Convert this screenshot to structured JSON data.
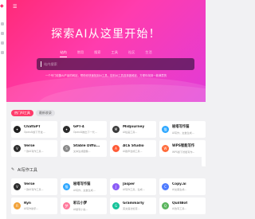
{
  "hero": {
    "title": "探索AI从这里开始！",
    "tabs": [
      "站内",
      "常用",
      "搜索",
      "工具",
      "社区",
      "生活"
    ],
    "search_placeholder": "站内搜索",
    "subtitle": "一个专门收集AI产品的网站，帮助你快速找到AI工具，告别AI工具选择困难症，方便你找到一款满意的"
  },
  "filters": [
    "热门AI工具",
    "最新收录"
  ],
  "section_title": "AI写作工具",
  "icons": {
    "menu": "hamburger-icon",
    "section": "pen-icon"
  },
  "cards_top": [
    {
      "name": "ChatGPT",
      "desc": "OpenAI旗下开发...",
      "icon_text": "✦",
      "color": "#1f1f1f"
    },
    {
      "name": "GPT-4",
      "desc": "OpenAI推出下一代...",
      "icon_text": "✦",
      "color": "#2b2b2b"
    },
    {
      "name": "Midjourney",
      "desc": "AI绘画工具...",
      "icon_text": "M",
      "color": "#3a3a3a"
    },
    {
      "name": "秘塔写作猫",
      "desc": "AI写作，文章生成...",
      "icon_text": "猫",
      "color": "#2da7ff"
    },
    {
      "name": "Verse",
      "desc": "一款AI写作工具...",
      "icon_text": "V",
      "color": "#2c2c2c"
    },
    {
      "name": "Stable Diffu...",
      "desc": "文本生成图像...",
      "icon_text": "S",
      "color": "#8a8a8a"
    },
    {
      "name": "ACE Studio",
      "desc": "AI歌声合成工具...",
      "icon_text": "A",
      "color": "#ff5a36"
    },
    {
      "name": "WPS智能写作",
      "desc": "WPS旗下智能写作...",
      "icon_text": "W",
      "color": "#ff6b3b"
    }
  ],
  "cards_bottom": [
    {
      "name": "Verse",
      "desc": "一款AI写作工具...",
      "icon_text": "V",
      "color": "#2c2c2c"
    },
    {
      "name": "秘塔写作猫",
      "desc": "AI写作，文章生成...",
      "icon_text": "猫",
      "color": "#2da7ff"
    },
    {
      "name": "Jasper",
      "desc": "AI写作工具，生成...",
      "icon_text": "J",
      "color": "#8b5cf6"
    },
    {
      "name": "Copy.ai",
      "desc": "AI文案生成...",
      "icon_text": "C",
      "color": "#4f7cff"
    },
    {
      "name": "Ryn",
      "desc": "AI写作助手...",
      "icon_text": "R",
      "color": "#f2a33a"
    },
    {
      "name": "彩云小梦",
      "desc": "AI续写小说...",
      "icon_text": "梦",
      "color": "#ff7a9c"
    },
    {
      "name": "Grammarly",
      "desc": "英文语法检查...",
      "icon_text": "G",
      "color": "#15c39a"
    },
    {
      "name": "QuillBot",
      "desc": "AI改写工具...",
      "icon_text": "Q",
      "color": "#5ab55e"
    }
  ]
}
